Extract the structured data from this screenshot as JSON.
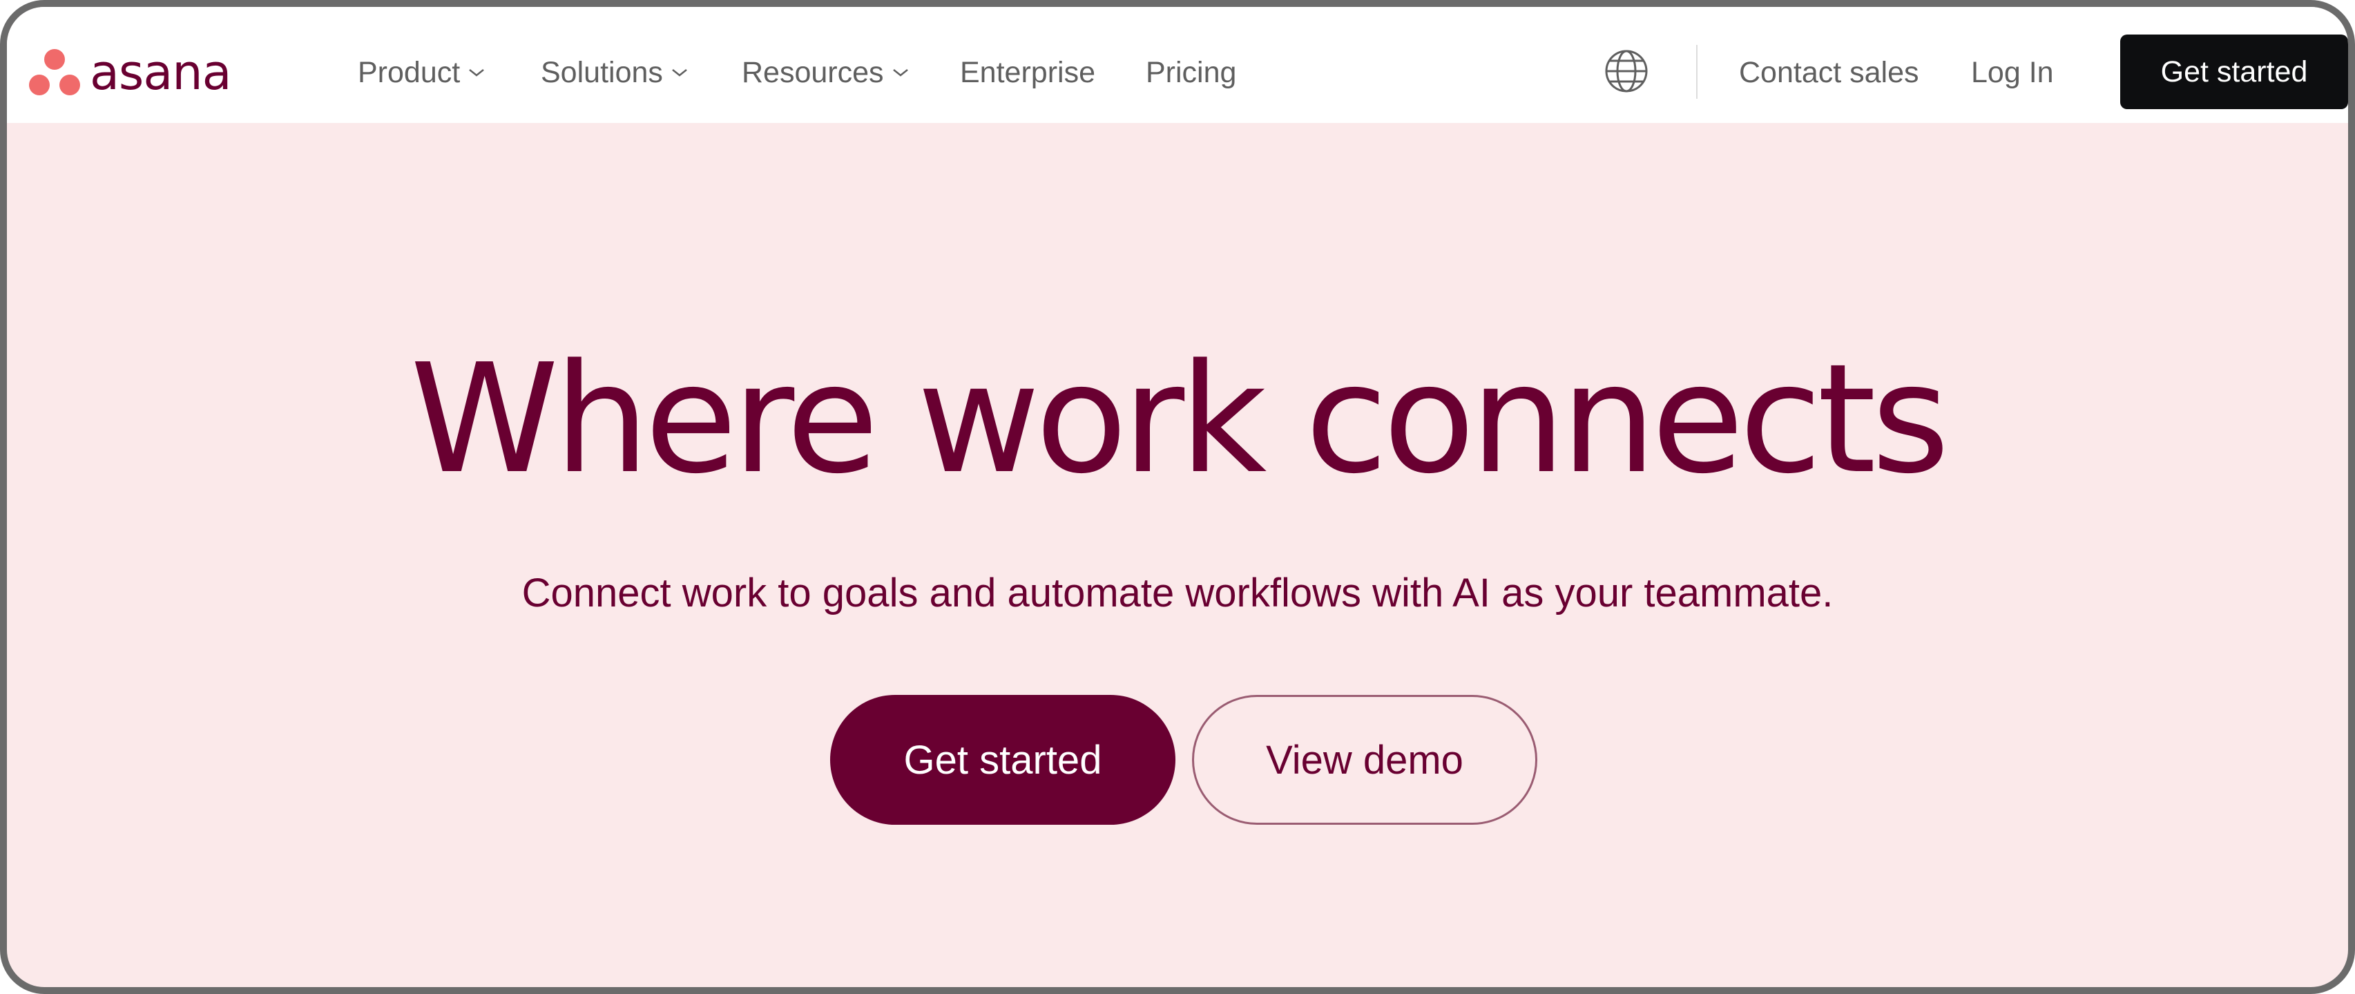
{
  "brand": {
    "name": "asana",
    "dot_color": "#f06a6a",
    "text_color": "#690031"
  },
  "nav": {
    "items": [
      {
        "label": "Product",
        "has_dropdown": true
      },
      {
        "label": "Solutions",
        "has_dropdown": true
      },
      {
        "label": "Resources",
        "has_dropdown": true
      },
      {
        "label": "Enterprise",
        "has_dropdown": false
      },
      {
        "label": "Pricing",
        "has_dropdown": false
      }
    ],
    "language_icon": "globe-icon",
    "contact_sales": "Contact sales",
    "log_in": "Log In",
    "get_started": "Get started"
  },
  "hero": {
    "title": "Where work connects",
    "subtitle": "Connect work to goals and automate workflows with AI as your teammate.",
    "primary_cta": "Get started",
    "secondary_cta": "View demo"
  },
  "colors": {
    "hero_background": "#fbe9ea",
    "accent": "#690031",
    "nav_button_background": "#0d0e10",
    "nav_text": "#5f5f5f"
  }
}
